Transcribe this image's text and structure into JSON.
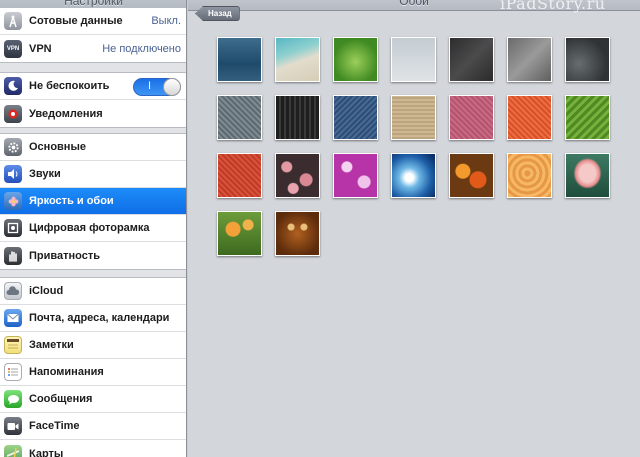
{
  "sidebar": {
    "title": "Настройки",
    "groups": [
      {
        "items": [
          {
            "label": "Сотовые данные",
            "value": "Выкл.",
            "icon": "antenna-icon"
          },
          {
            "label": "VPN",
            "value": "Не подключено",
            "icon": "vpn-icon",
            "icon_text": "VPN"
          }
        ]
      },
      {
        "items": [
          {
            "label": "Не беспокоить",
            "toggle_on": true,
            "toggle_text": "I",
            "icon": "moon-icon"
          },
          {
            "label": "Уведомления",
            "icon": "notifications-icon"
          }
        ]
      },
      {
        "items": [
          {
            "label": "Основные",
            "icon": "gear-icon"
          },
          {
            "label": "Звуки",
            "icon": "speaker-icon"
          },
          {
            "label": "Яркость и обои",
            "icon": "flower-icon",
            "selected": true
          },
          {
            "label": "Цифровая фоторамка",
            "icon": "photo-frame-icon"
          },
          {
            "label": "Приватность",
            "icon": "hand-icon"
          }
        ]
      },
      {
        "items": [
          {
            "label": "iCloud",
            "icon": "cloud-icon"
          },
          {
            "label": "Почта, адреса, календари",
            "icon": "mail-icon"
          },
          {
            "label": "Заметки",
            "icon": "notes-icon"
          },
          {
            "label": "Напоминания",
            "icon": "reminders-icon"
          },
          {
            "label": "Сообщения",
            "icon": "messages-icon"
          },
          {
            "label": "FaceTime",
            "icon": "facetime-icon"
          },
          {
            "label": "Карты",
            "icon": "maps-icon"
          }
        ]
      }
    ]
  },
  "main": {
    "title": "Обои",
    "back_label": "Назад",
    "watermark": "iPadStory.ru"
  },
  "wallpapers": [
    {
      "name": "water-blue"
    },
    {
      "name": "beach-sand"
    },
    {
      "name": "green-grass"
    },
    {
      "name": "raindrops-gray"
    },
    {
      "name": "dark-stone"
    },
    {
      "name": "gray-rock"
    },
    {
      "name": "dark-slate"
    },
    {
      "name": "gravel-texture"
    },
    {
      "name": "black-stripes"
    },
    {
      "name": "denim-blue"
    },
    {
      "name": "burlap-beige"
    },
    {
      "name": "pink-fabric"
    },
    {
      "name": "orange-weave"
    },
    {
      "name": "green-wave"
    },
    {
      "name": "red-leather"
    },
    {
      "name": "cherry-blossom"
    },
    {
      "name": "purple-flowers"
    },
    {
      "name": "ocean-wave"
    },
    {
      "name": "autumn-leaves"
    },
    {
      "name": "wood-rings"
    },
    {
      "name": "lotus-flower"
    },
    {
      "name": "orange-flowers"
    },
    {
      "name": "tribal-mask"
    }
  ],
  "colors": {
    "selected_row": "#0f6ee8",
    "toggle_on": "#1a70e5",
    "value_text": "#4a6293"
  }
}
